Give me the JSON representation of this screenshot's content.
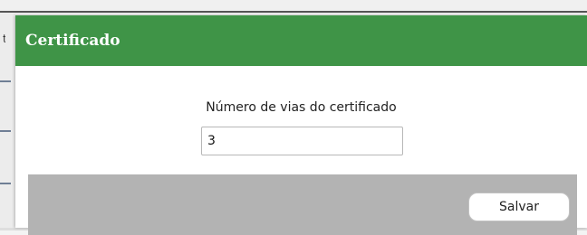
{
  "dialog": {
    "title": "Certificado",
    "header_color": "#3f9447",
    "field": {
      "label": "Número de vias do certificado",
      "value": "3"
    },
    "footer": {
      "save_label": "Salvar"
    }
  },
  "backdrop": {
    "edge_glyph": "t"
  }
}
